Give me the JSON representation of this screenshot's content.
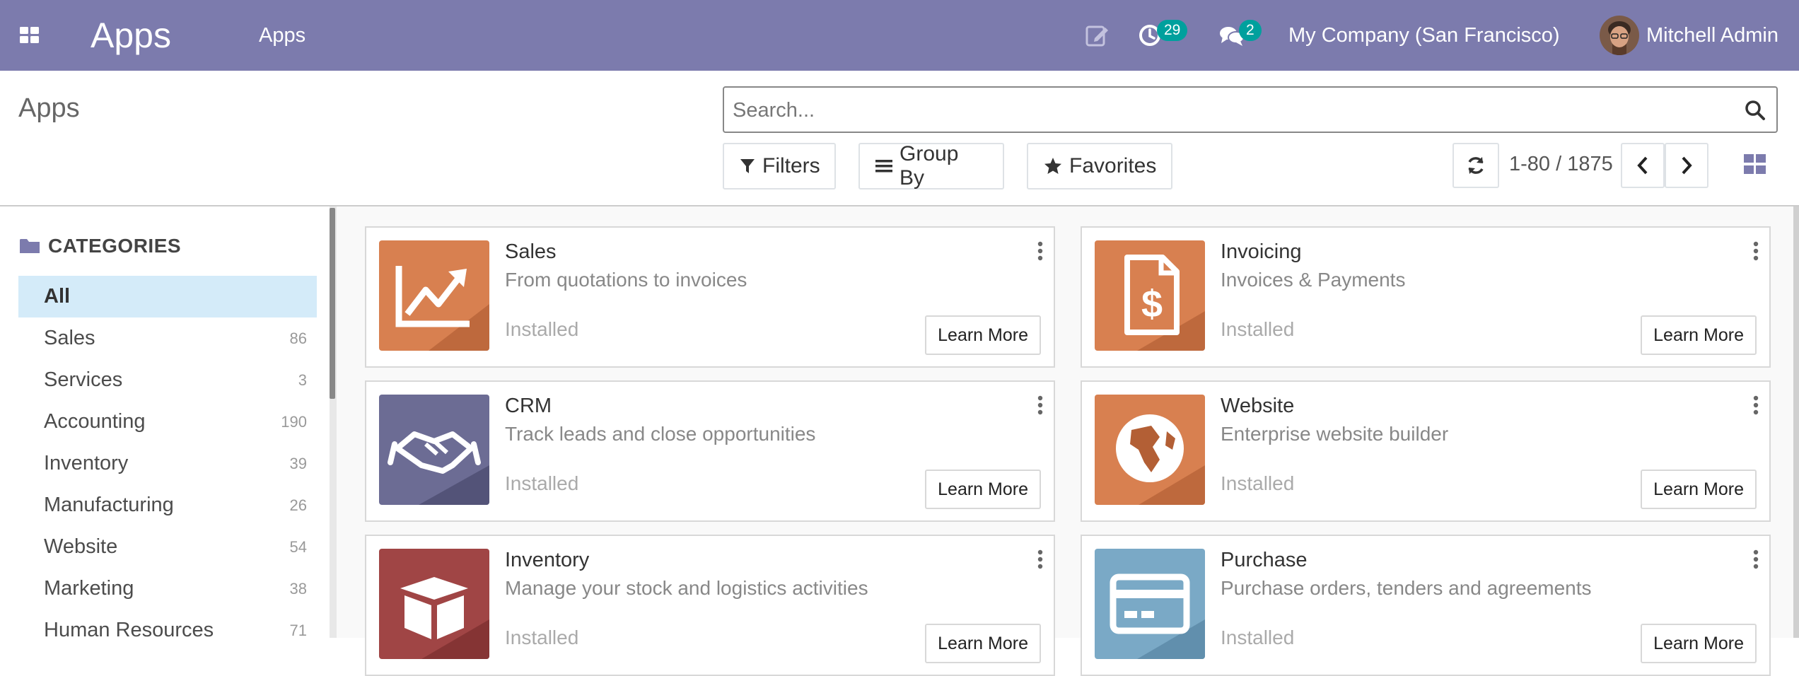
{
  "navbar": {
    "brand": "Apps",
    "menu_item": "Apps",
    "activity_count": "29",
    "message_count": "2",
    "company": "My Company (San Francisco)",
    "user": "Mitchell Admin",
    "bg_color": "#7c7bad",
    "badge_color": "#00a09d"
  },
  "control_panel": {
    "breadcrumb": "Apps",
    "search_placeholder": "Search...",
    "filters_label": "Filters",
    "groupby_label": "Group By",
    "favorites_label": "Favorites",
    "pager": "1-80 / 1875"
  },
  "sidebar": {
    "header": "CATEGORIES",
    "items": [
      {
        "label": "All",
        "count": ""
      },
      {
        "label": "Sales",
        "count": "86"
      },
      {
        "label": "Services",
        "count": "3"
      },
      {
        "label": "Accounting",
        "count": "190"
      },
      {
        "label": "Inventory",
        "count": "39"
      },
      {
        "label": "Manufacturing",
        "count": "26"
      },
      {
        "label": "Website",
        "count": "54"
      },
      {
        "label": "Marketing",
        "count": "38"
      },
      {
        "label": "Human Resources",
        "count": "71"
      }
    ]
  },
  "apps": [
    {
      "name": "Sales",
      "desc": "From quotations to invoices",
      "status": "Installed",
      "button": "Learn More",
      "icon": "chart-up-icon",
      "color": "#c96b3e"
    },
    {
      "name": "Invoicing",
      "desc": "Invoices & Payments",
      "status": "Installed",
      "button": "Learn More",
      "icon": "invoice-dollar-icon",
      "color": "#c96b3e"
    },
    {
      "name": "CRM",
      "desc": "Track leads and close opportunities",
      "status": "Installed",
      "button": "Learn More",
      "icon": "handshake-icon",
      "color": "#5e5f83"
    },
    {
      "name": "Website",
      "desc": "Enterprise website builder",
      "status": "Installed",
      "button": "Learn More",
      "icon": "globe-icon",
      "color": "#c96b3e"
    },
    {
      "name": "Inventory",
      "desc": "Manage your stock and logistics activities",
      "status": "Installed",
      "button": "Learn More",
      "icon": "box-icon",
      "color": "#923a3a"
    },
    {
      "name": "Purchase",
      "desc": "Purchase orders, tenders and agreements",
      "status": "Installed",
      "button": "Learn More",
      "icon": "credit-card-icon",
      "color": "#6d9bb9"
    }
  ]
}
